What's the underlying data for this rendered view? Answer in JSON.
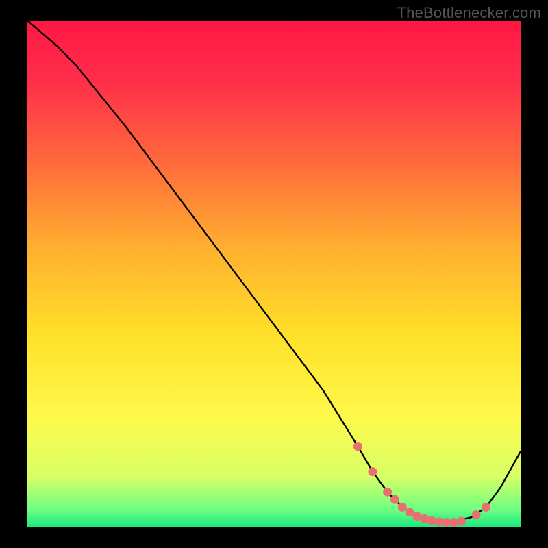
{
  "watermark": "TheBottlenecker.com",
  "chart_data": {
    "type": "line",
    "title": "",
    "xlabel": "",
    "ylabel": "",
    "xlim": [
      0,
      100
    ],
    "ylim": [
      0,
      100
    ],
    "series": [
      {
        "name": "curve",
        "x": [
          0,
          6,
          10,
          20,
          30,
          40,
          50,
          60,
          67,
          70,
          73,
          76,
          80,
          83,
          86,
          90,
          93,
          96,
          100
        ],
        "y": [
          100,
          95,
          91,
          79,
          66,
          53,
          40,
          27,
          16,
          11,
          7,
          4,
          1.5,
          1,
          1,
          2,
          4,
          8,
          15
        ]
      }
    ],
    "highlight_points": {
      "name": "markers",
      "color": "#e87070",
      "x": [
        67,
        70,
        73,
        74.5,
        76,
        77.5,
        79,
        80.5,
        82,
        83.5,
        85,
        86.5,
        88,
        91,
        93
      ],
      "y": [
        16,
        11,
        7,
        5.5,
        4,
        3,
        2.2,
        1.7,
        1.3,
        1.1,
        1.0,
        1.0,
        1.2,
        2.5,
        4
      ]
    },
    "background_gradient": {
      "stops": [
        {
          "offset": 0.0,
          "color": "#ff1744"
        },
        {
          "offset": 0.12,
          "color": "#ff2e4a"
        },
        {
          "offset": 0.28,
          "color": "#ff6a3c"
        },
        {
          "offset": 0.45,
          "color": "#ffb02f"
        },
        {
          "offset": 0.62,
          "color": "#ffe029"
        },
        {
          "offset": 0.78,
          "color": "#fff94b"
        },
        {
          "offset": 0.9,
          "color": "#d7ff66"
        },
        {
          "offset": 0.965,
          "color": "#6eff82"
        },
        {
          "offset": 1.0,
          "color": "#17e87e"
        }
      ]
    }
  }
}
